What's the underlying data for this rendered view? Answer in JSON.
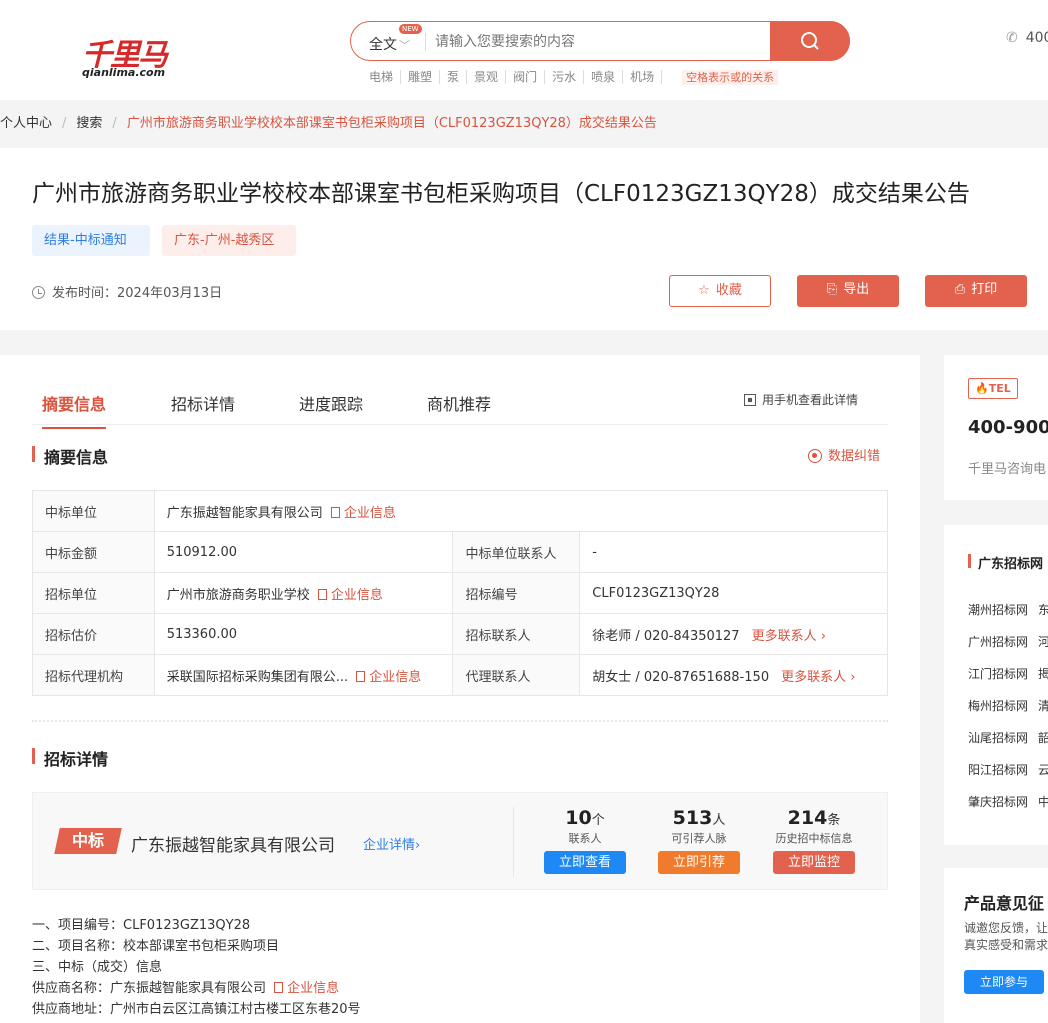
{
  "header": {
    "logo_text": "千里马",
    "logo_sub": "qianlima.com",
    "search": {
      "scope": "全文",
      "new_badge": "NEW",
      "placeholder": "请输入您要搜索的内容"
    },
    "hot_words": [
      "电梯",
      "雕塑",
      "泵",
      "景观",
      "阀门",
      "污水",
      "喷泉",
      "机场"
    ],
    "hint": "空格表示或的关系",
    "phone": "400"
  },
  "breadcrumb": {
    "items": [
      "个人中心",
      "搜索"
    ],
    "current": "广州市旅游商务职业学校校本部课室书包柜采购项目（CLF0123GZ13QY28）成交结果公告"
  },
  "article": {
    "title": "广州市旅游商务职业学校校本部课室书包柜采购项目（CLF0123GZ13QY28）成交结果公告",
    "tags": [
      "结果-中标通知",
      "广东-广州-越秀区"
    ],
    "publish_label": "发布时间：",
    "publish_date": "2024年03月13日",
    "actions": {
      "favorite": "收藏",
      "export": "导出",
      "print": "打印"
    }
  },
  "tabs": [
    "摘要信息",
    "招标详情",
    "进度跟踪",
    "商机推荐"
  ],
  "mobile_view": "用手机查看此详情",
  "summary": {
    "title": "摘要信息",
    "correction": "数据纠错",
    "company_link": "企业信息",
    "more_contacts": "更多联系人",
    "rows": [
      {
        "k1": "中标单位",
        "v1": "广东振越智能家具有限公司"
      },
      {
        "k1": "中标金额",
        "v1": "510912.00",
        "k2": "中标单位联系人",
        "v2": "-"
      },
      {
        "k1": "招标单位",
        "v1": "广州市旅游商务职业学校",
        "k2": "招标编号",
        "v2": "CLF0123GZ13QY28"
      },
      {
        "k1": "招标估价",
        "v1": "513360.00",
        "k2": "招标联系人",
        "v2": "徐老师 / 020-84350127"
      },
      {
        "k1": "招标代理机构",
        "v1": "采联国际招标采购集团有限公...",
        "k2": "代理联系人",
        "v2": "胡女士 / 020-87651688-150"
      }
    ]
  },
  "bid_detail": {
    "title": "招标详情",
    "badge": "中标",
    "company": "广东振越智能家具有限公司",
    "company_link": "企业详情",
    "stats": [
      {
        "num": "10",
        "unit": "个",
        "label": "联系人",
        "button": "立即查看",
        "color": "#1e88f5"
      },
      {
        "num": "513",
        "unit": "人",
        "label": "可引荐人脉",
        "button": "立即引荐",
        "color": "#f07b2c"
      },
      {
        "num": "214",
        "unit": "条",
        "label": "历史招中标信息",
        "button": "立即监控",
        "color": "#e2624d"
      }
    ]
  },
  "details": {
    "line1": "一、项目编号：CLF0123GZ13QY28",
    "line2": "二、项目名称：校本部课室书包柜采购项目",
    "line3": "三、中标（成交）信息",
    "line4": "供应商名称：广东振越智能家具有限公司",
    "line4_link": "企业信息",
    "line5": "供应商地址：广州市白云区江高镇江村古楼工区东巷20号"
  },
  "sidebar": {
    "tel_badge": "TEL",
    "tel_number": "400-900-",
    "tel_desc": "千里马咨询电",
    "net_title": "广东招标网",
    "net_items": [
      {
        "a": "潮州招标网",
        "b": "东"
      },
      {
        "a": "广州招标网",
        "b": "河"
      },
      {
        "a": "江门招标网",
        "b": "揭"
      },
      {
        "a": "梅州招标网",
        "b": "清"
      },
      {
        "a": "汕尾招标网",
        "b": "韶"
      },
      {
        "a": "阳江招标网",
        "b": "云"
      },
      {
        "a": "肇庆招标网",
        "b": "中"
      }
    ],
    "feedback_title": "产品意见征",
    "feedback_desc1": "诚邀您反馈，让",
    "feedback_desc2": "真实感受和需求",
    "feedback_button": "立即参与"
  }
}
